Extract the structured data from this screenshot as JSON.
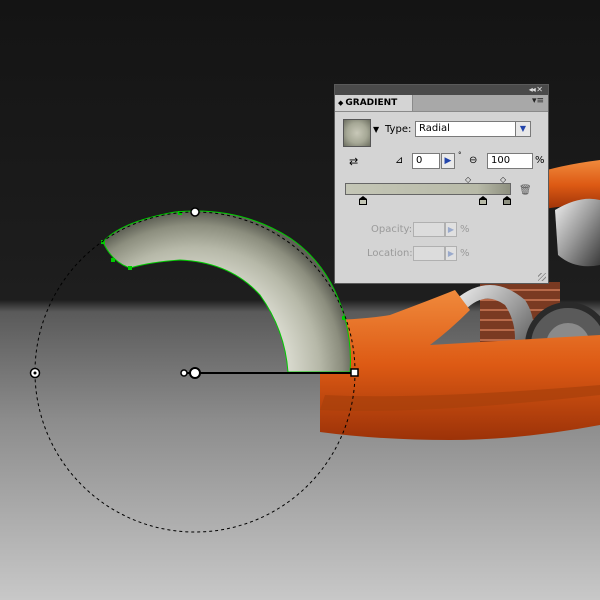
{
  "canvas": {
    "colors": {
      "background_top": "#161616",
      "floor_bottom": "#c8c8c8",
      "accent_orange": "#e8641c",
      "selection_green": "#00cc00"
    },
    "tool": "gradient-annotator",
    "shape": "crescent-fender",
    "gradient_fill": "radial"
  },
  "panel": {
    "title": "GRADIENT",
    "type_label": "Type:",
    "type_value": "Radial",
    "type_options": [
      "Radial"
    ],
    "angle_value": "0",
    "degree_symbol": "°",
    "aspect_value": "100",
    "aspect_unit": "%",
    "opacity_label": "Opacity:",
    "opacity_unit": "%",
    "location_label": "Location:",
    "location_unit": "%",
    "gradient_colors": [
      "#c4c6b6",
      "#b8baa8",
      "#8e9080"
    ],
    "stops_count": 3
  }
}
